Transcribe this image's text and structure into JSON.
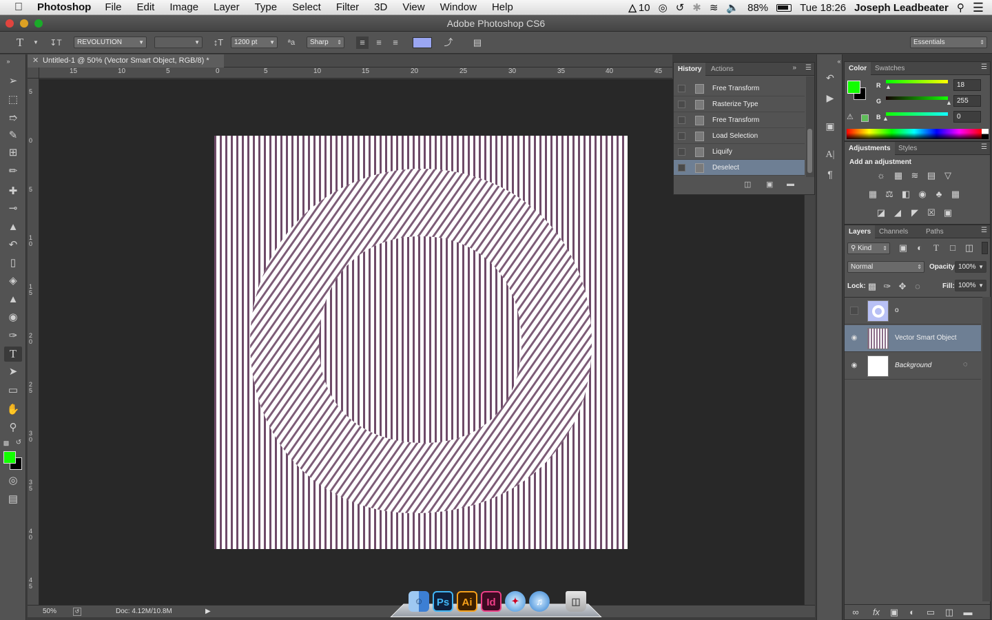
{
  "menubar": {
    "app_name": "Photoshop",
    "items": [
      "File",
      "Edit",
      "Image",
      "Layer",
      "Type",
      "Select",
      "Filter",
      "3D",
      "View",
      "Window",
      "Help"
    ],
    "adobe_count": "10",
    "battery": "88%",
    "clock": "Tue 18:26",
    "user": "Joseph Leadbeater"
  },
  "window": {
    "title": "Adobe Photoshop CS6"
  },
  "options_bar": {
    "font_family": "REVOLUTION",
    "font_style": "",
    "font_size": "1200 pt",
    "anti_alias": "Sharp",
    "text_color": "#9aa6f2",
    "workspace": "Essentials"
  },
  "document": {
    "tab_title": "Untitled-1 @ 50% (Vector Smart Object, RGB/8) *",
    "zoom": "50%",
    "doc_size": "Doc: 4.12M/10.8M",
    "h_ruler_labels": [
      "15",
      "10",
      "5",
      "0",
      "5",
      "10",
      "15",
      "20",
      "25",
      "30",
      "35",
      "40",
      "45"
    ],
    "v_ruler_labels": [
      "5",
      "0",
      "5",
      "1 0",
      "1 5",
      "2 0",
      "2 5",
      "3 0",
      "3 5",
      "4 0",
      "4 5"
    ],
    "stripe_color": "#6e4a68"
  },
  "history": {
    "tabs": [
      "History",
      "Actions"
    ],
    "items": [
      "Free Transform",
      "Rasterize Type",
      "Free Transform",
      "Load Selection",
      "Liquify",
      "Deselect"
    ],
    "selected_index": 5
  },
  "color": {
    "tabs": [
      "Color",
      "Swatches"
    ],
    "foreground": "#12ff00",
    "background": "#000000",
    "r_label": "R",
    "g_label": "G",
    "b_label": "B",
    "r": "18",
    "g": "255",
    "b": "0"
  },
  "adjustments": {
    "tabs": [
      "Adjustments",
      "Styles"
    ],
    "heading": "Add an adjustment"
  },
  "layers": {
    "tabs": [
      "Layers",
      "Channels",
      "Paths"
    ],
    "filter_kind": "Kind",
    "blend_mode": "Normal",
    "opacity_label": "Opacity:",
    "opacity": "100%",
    "lock_label": "Lock:",
    "fill_label": "Fill:",
    "fill": "100%",
    "items": [
      {
        "name": "o"
      },
      {
        "name": "Vector Smart Object"
      },
      {
        "name": "Background"
      }
    ]
  },
  "dock": {
    "apps": [
      "Finder",
      "Ps",
      "Ai",
      "Id",
      "Safari",
      "iTunes",
      "Trash"
    ]
  }
}
